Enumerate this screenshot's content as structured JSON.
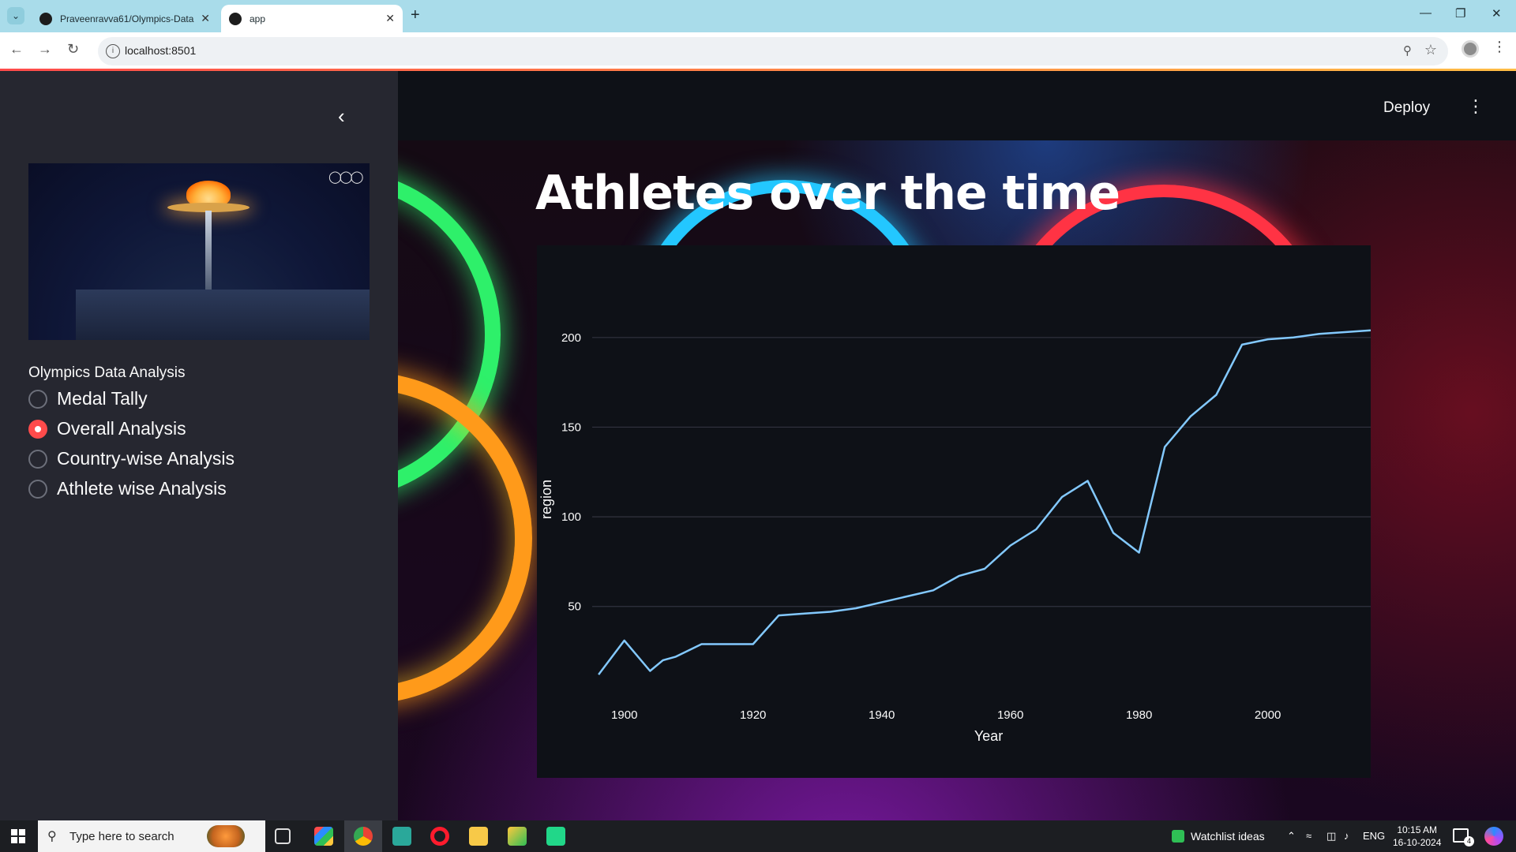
{
  "browser": {
    "tabs": [
      {
        "title": "Praveenravva61/Olympics-Data"
      },
      {
        "title": "app"
      }
    ],
    "url": "localhost:8501"
  },
  "sidebar": {
    "radio_label": "Olympics Data Analysis",
    "options": [
      {
        "label": "Medal Tally",
        "selected": false
      },
      {
        "label": "Overall Analysis",
        "selected": true
      },
      {
        "label": "Country-wise Analysis",
        "selected": false
      },
      {
        "label": "Athlete wise Analysis",
        "selected": false
      }
    ]
  },
  "header": {
    "deploy_label": "Deploy"
  },
  "main": {
    "title": "Athletes over the time"
  },
  "chart_data": {
    "type": "line",
    "xlabel": "Year",
    "ylabel": "region",
    "xlim": [
      1895,
      2016
    ],
    "ylim": [
      5,
      225
    ],
    "x_ticks": [
      1900,
      1920,
      1940,
      1960,
      1980,
      2000
    ],
    "y_ticks": [
      50,
      100,
      150,
      200
    ],
    "grid": "horizontal",
    "line_color": "#83c9ff",
    "series": [
      {
        "x": [
          1896,
          1900,
          1904,
          1906,
          1908,
          1912,
          1920,
          1924,
          1928,
          1932,
          1936,
          1948,
          1952,
          1956,
          1960,
          1964,
          1968,
          1972,
          1976,
          1980,
          1984,
          1988,
          1992,
          1996,
          2000,
          2004,
          2008,
          2016
        ],
        "y": [
          12,
          31,
          14,
          20,
          22,
          29,
          29,
          45,
          46,
          47,
          49,
          59,
          67,
          71,
          84,
          93,
          111,
          120,
          91,
          80,
          139,
          156,
          168,
          196,
          199,
          200,
          202,
          204
        ]
      }
    ]
  },
  "taskbar": {
    "search_placeholder": "Type here to search",
    "watchlist_label": "Watchlist ideas",
    "language": "ENG",
    "time": "10:15 AM",
    "date": "16-10-2024",
    "notification_count": "4"
  }
}
